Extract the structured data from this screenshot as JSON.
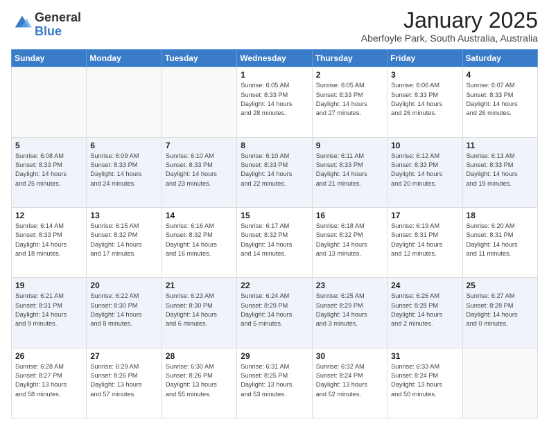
{
  "logo": {
    "line1": "General",
    "line2": "Blue"
  },
  "header": {
    "month": "January 2025",
    "location": "Aberfoyle Park, South Australia, Australia"
  },
  "weekdays": [
    "Sunday",
    "Monday",
    "Tuesday",
    "Wednesday",
    "Thursday",
    "Friday",
    "Saturday"
  ],
  "weeks": [
    [
      {
        "day": "",
        "info": ""
      },
      {
        "day": "",
        "info": ""
      },
      {
        "day": "",
        "info": ""
      },
      {
        "day": "1",
        "info": "Sunrise: 6:05 AM\nSunset: 8:33 PM\nDaylight: 14 hours\nand 28 minutes."
      },
      {
        "day": "2",
        "info": "Sunrise: 6:05 AM\nSunset: 8:33 PM\nDaylight: 14 hours\nand 27 minutes."
      },
      {
        "day": "3",
        "info": "Sunrise: 6:06 AM\nSunset: 8:33 PM\nDaylight: 14 hours\nand 26 minutes."
      },
      {
        "day": "4",
        "info": "Sunrise: 6:07 AM\nSunset: 8:33 PM\nDaylight: 14 hours\nand 26 minutes."
      }
    ],
    [
      {
        "day": "5",
        "info": "Sunrise: 6:08 AM\nSunset: 8:33 PM\nDaylight: 14 hours\nand 25 minutes."
      },
      {
        "day": "6",
        "info": "Sunrise: 6:09 AM\nSunset: 8:33 PM\nDaylight: 14 hours\nand 24 minutes."
      },
      {
        "day": "7",
        "info": "Sunrise: 6:10 AM\nSunset: 8:33 PM\nDaylight: 14 hours\nand 23 minutes."
      },
      {
        "day": "8",
        "info": "Sunrise: 6:10 AM\nSunset: 8:33 PM\nDaylight: 14 hours\nand 22 minutes."
      },
      {
        "day": "9",
        "info": "Sunrise: 6:11 AM\nSunset: 8:33 PM\nDaylight: 14 hours\nand 21 minutes."
      },
      {
        "day": "10",
        "info": "Sunrise: 6:12 AM\nSunset: 8:33 PM\nDaylight: 14 hours\nand 20 minutes."
      },
      {
        "day": "11",
        "info": "Sunrise: 6:13 AM\nSunset: 8:33 PM\nDaylight: 14 hours\nand 19 minutes."
      }
    ],
    [
      {
        "day": "12",
        "info": "Sunrise: 6:14 AM\nSunset: 8:33 PM\nDaylight: 14 hours\nand 18 minutes."
      },
      {
        "day": "13",
        "info": "Sunrise: 6:15 AM\nSunset: 8:32 PM\nDaylight: 14 hours\nand 17 minutes."
      },
      {
        "day": "14",
        "info": "Sunrise: 6:16 AM\nSunset: 8:32 PM\nDaylight: 14 hours\nand 16 minutes."
      },
      {
        "day": "15",
        "info": "Sunrise: 6:17 AM\nSunset: 8:32 PM\nDaylight: 14 hours\nand 14 minutes."
      },
      {
        "day": "16",
        "info": "Sunrise: 6:18 AM\nSunset: 8:32 PM\nDaylight: 14 hours\nand 13 minutes."
      },
      {
        "day": "17",
        "info": "Sunrise: 6:19 AM\nSunset: 8:31 PM\nDaylight: 14 hours\nand 12 minutes."
      },
      {
        "day": "18",
        "info": "Sunrise: 6:20 AM\nSunset: 8:31 PM\nDaylight: 14 hours\nand 11 minutes."
      }
    ],
    [
      {
        "day": "19",
        "info": "Sunrise: 6:21 AM\nSunset: 8:31 PM\nDaylight: 14 hours\nand 9 minutes."
      },
      {
        "day": "20",
        "info": "Sunrise: 6:22 AM\nSunset: 8:30 PM\nDaylight: 14 hours\nand 8 minutes."
      },
      {
        "day": "21",
        "info": "Sunrise: 6:23 AM\nSunset: 8:30 PM\nDaylight: 14 hours\nand 6 minutes."
      },
      {
        "day": "22",
        "info": "Sunrise: 6:24 AM\nSunset: 8:29 PM\nDaylight: 14 hours\nand 5 minutes."
      },
      {
        "day": "23",
        "info": "Sunrise: 6:25 AM\nSunset: 8:29 PM\nDaylight: 14 hours\nand 3 minutes."
      },
      {
        "day": "24",
        "info": "Sunrise: 6:26 AM\nSunset: 8:28 PM\nDaylight: 14 hours\nand 2 minutes."
      },
      {
        "day": "25",
        "info": "Sunrise: 6:27 AM\nSunset: 8:28 PM\nDaylight: 14 hours\nand 0 minutes."
      }
    ],
    [
      {
        "day": "26",
        "info": "Sunrise: 6:28 AM\nSunset: 8:27 PM\nDaylight: 13 hours\nand 58 minutes."
      },
      {
        "day": "27",
        "info": "Sunrise: 6:29 AM\nSunset: 8:26 PM\nDaylight: 13 hours\nand 57 minutes."
      },
      {
        "day": "28",
        "info": "Sunrise: 6:30 AM\nSunset: 8:26 PM\nDaylight: 13 hours\nand 55 minutes."
      },
      {
        "day": "29",
        "info": "Sunrise: 6:31 AM\nSunset: 8:25 PM\nDaylight: 13 hours\nand 53 minutes."
      },
      {
        "day": "30",
        "info": "Sunrise: 6:32 AM\nSunset: 8:24 PM\nDaylight: 13 hours\nand 52 minutes."
      },
      {
        "day": "31",
        "info": "Sunrise: 6:33 AM\nSunset: 8:24 PM\nDaylight: 13 hours\nand 50 minutes."
      },
      {
        "day": "",
        "info": ""
      }
    ]
  ]
}
